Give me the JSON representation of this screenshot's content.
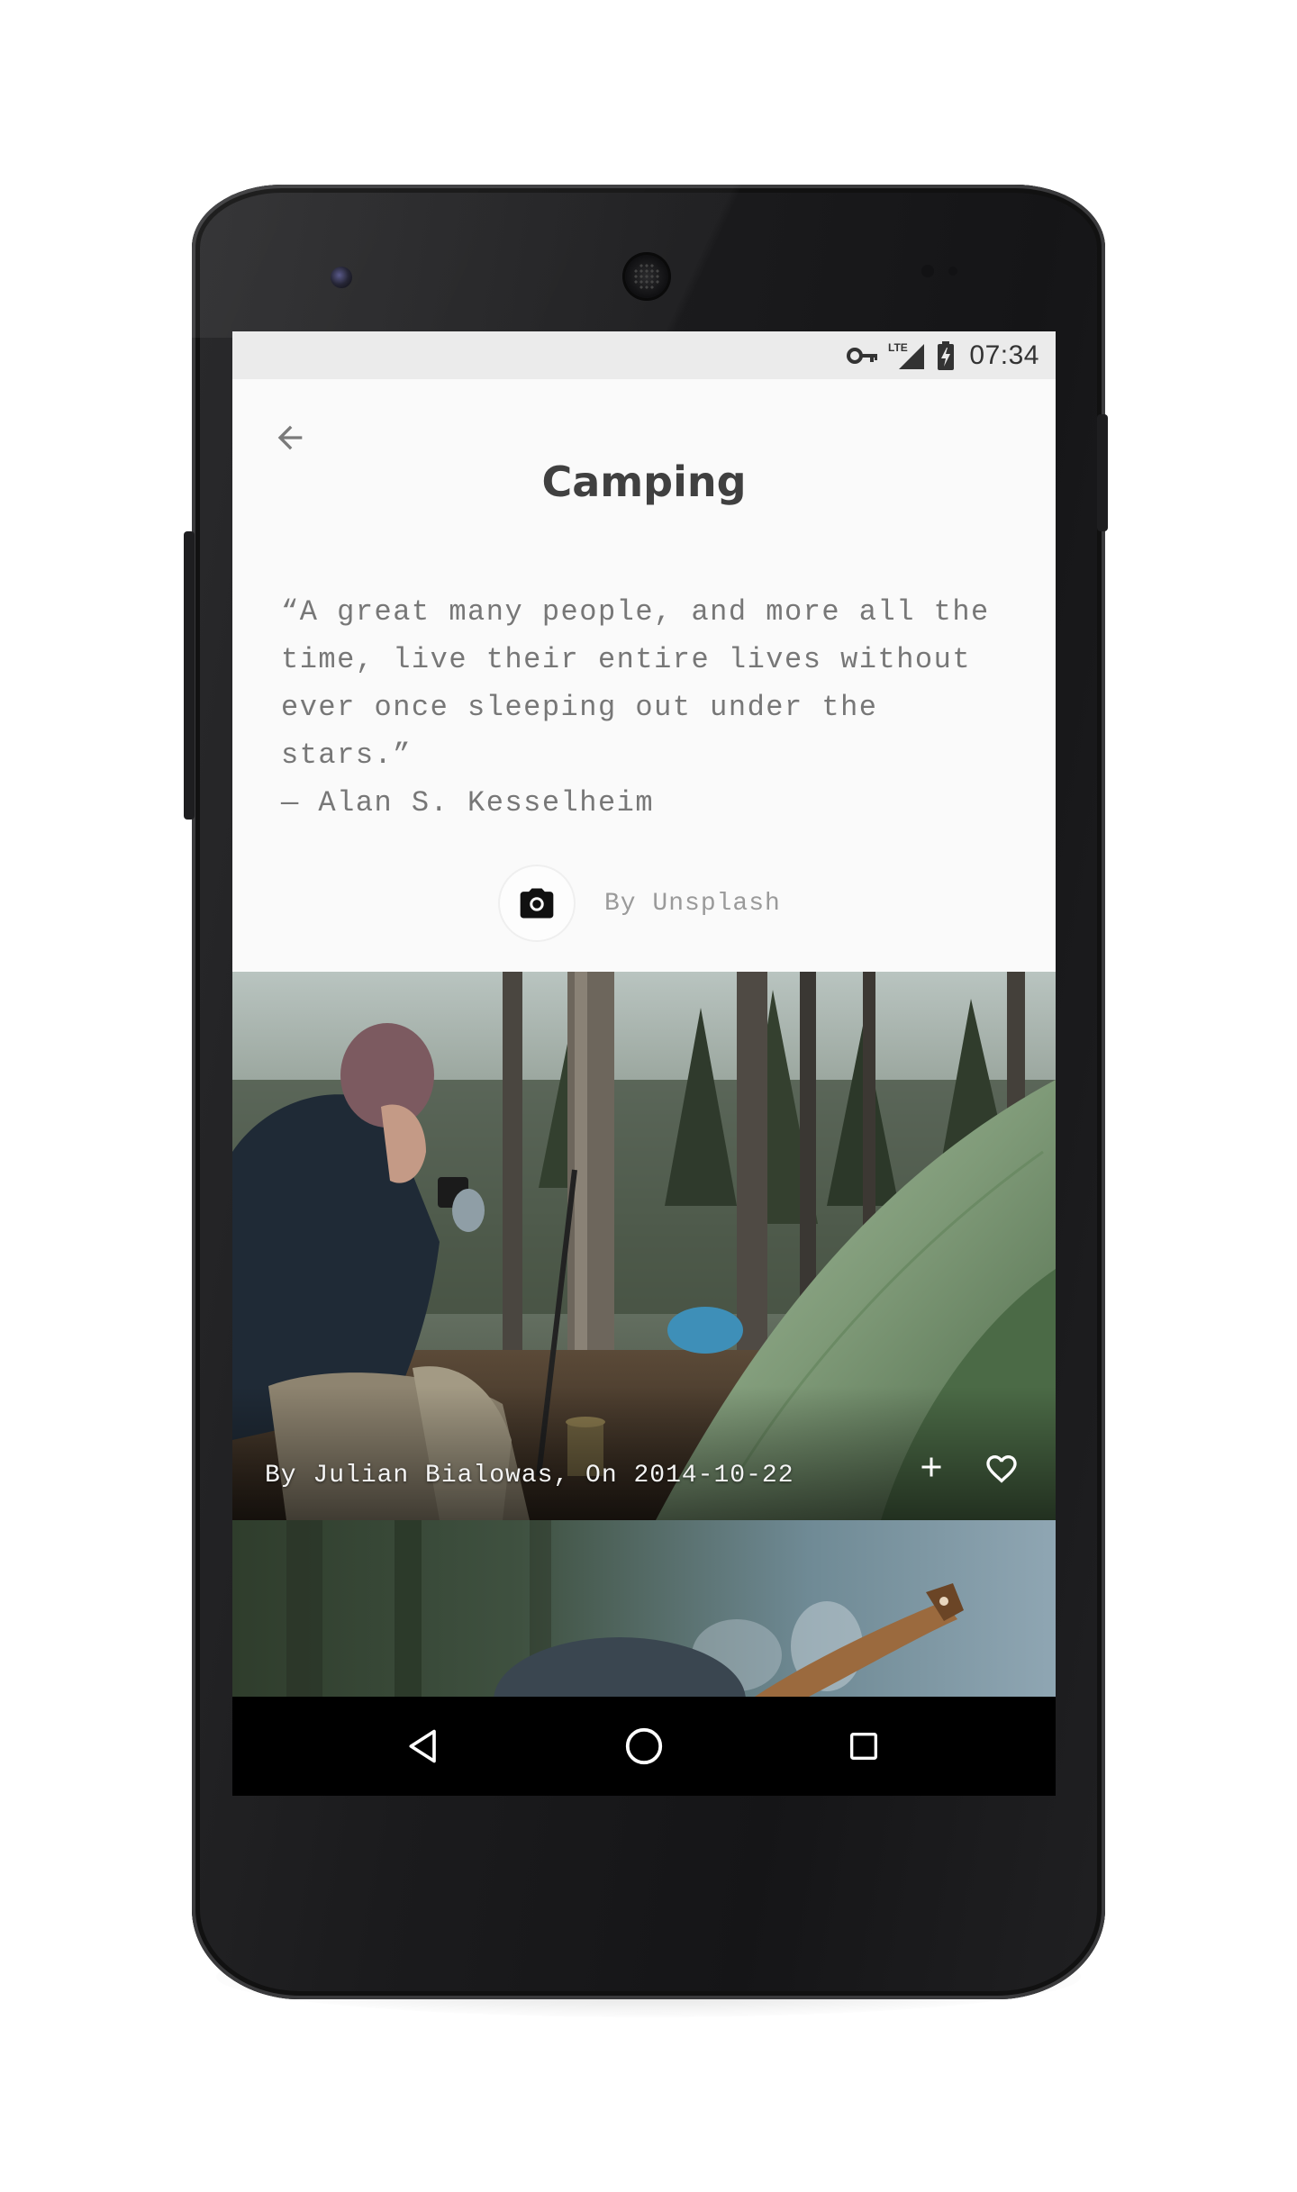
{
  "status_bar": {
    "time": "07:34",
    "network": "LTE",
    "icons": [
      "vpn-key-icon",
      "lte-signal-icon",
      "battery-charging-icon"
    ]
  },
  "header": {
    "title": "Camping",
    "back_icon": "arrow-back-icon"
  },
  "quote": {
    "lines": [
      "“A great many people, and more all the",
      "time, live their entire lives without",
      "ever once sleeping out under the",
      "stars.”",
      "— Alan S. Kesselheim"
    ]
  },
  "source_credit": {
    "icon": "camera-icon",
    "text": "By Unsplash"
  },
  "photos": [
    {
      "caption": "By Julian Bialowas, On 2014-10-22",
      "actions": [
        "add-icon",
        "heart-outline-icon"
      ]
    },
    {
      "caption": ""
    }
  ],
  "nav_bar": {
    "buttons": [
      "back-triangle-icon",
      "home-circle-icon",
      "recents-square-icon"
    ]
  },
  "colors": {
    "screen_background": "#fafafa",
    "status_bar_background": "#ebebeb",
    "title_text": "#404040",
    "quote_text": "#777777",
    "credit_text": "#9a9a9a",
    "nav_bar_background": "#000000",
    "phone_body": "#1b1b1d"
  }
}
